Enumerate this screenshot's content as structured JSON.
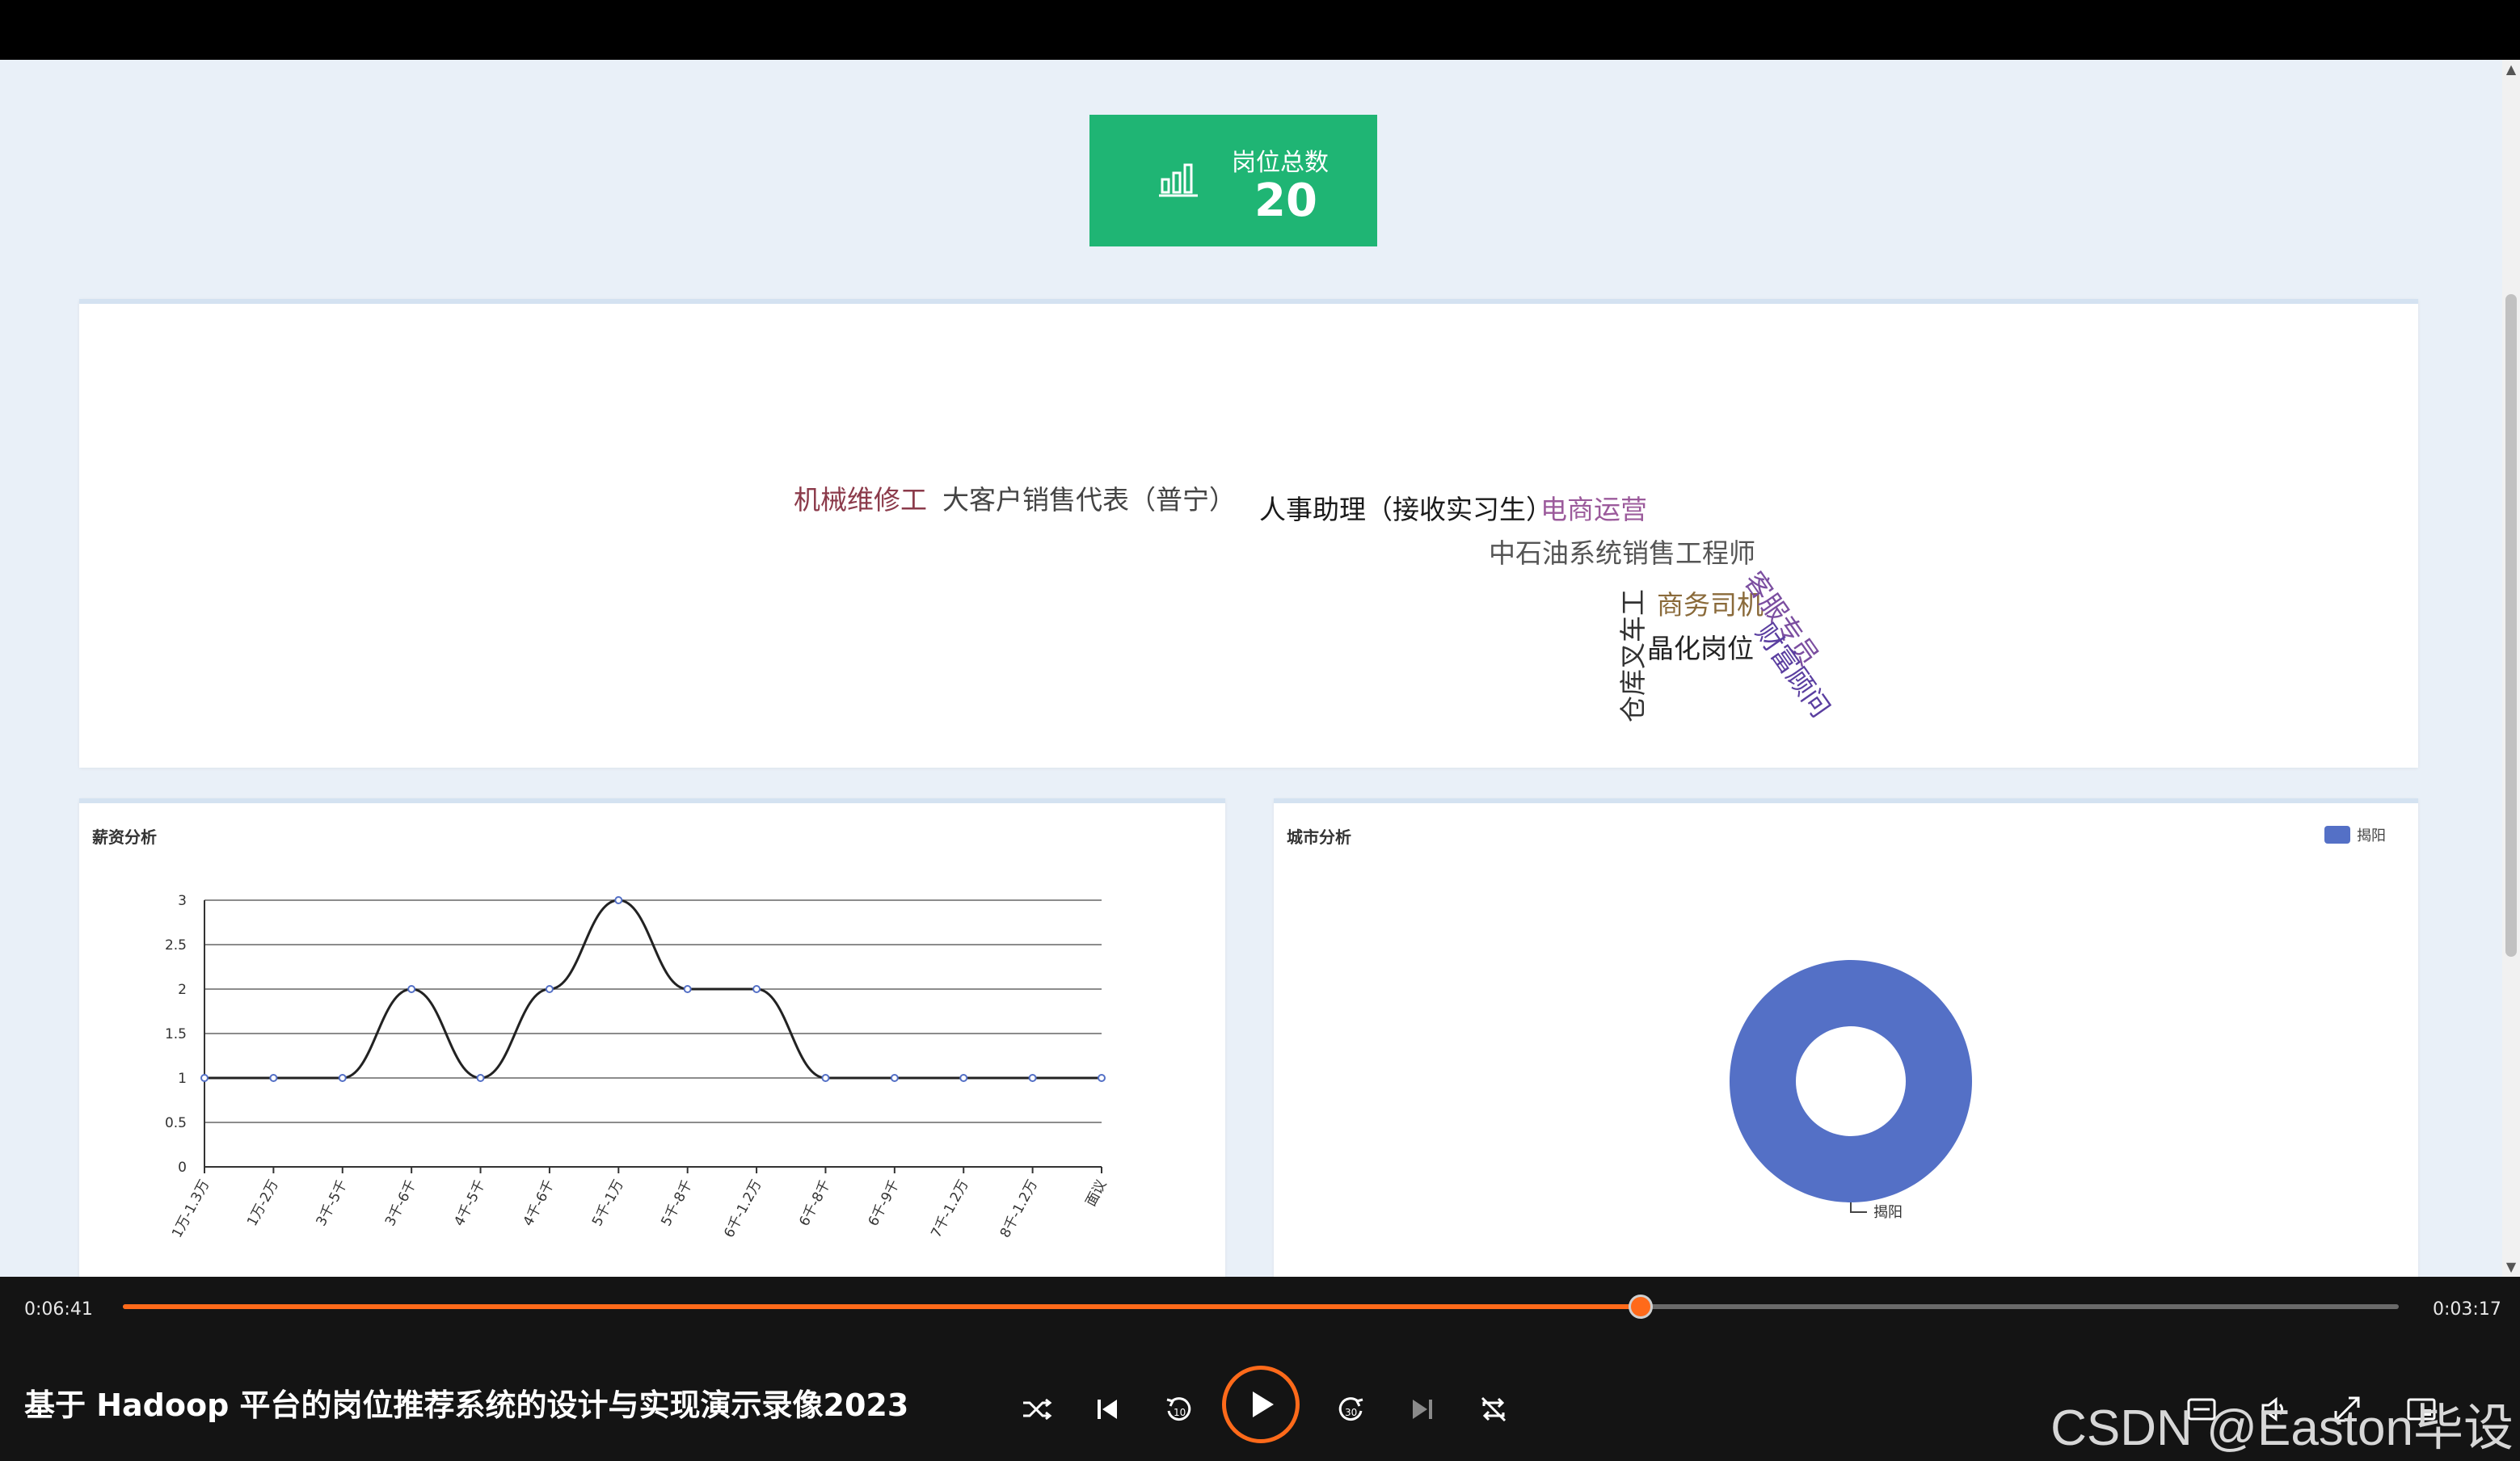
{
  "stat": {
    "label": "岗位总数",
    "value": "20"
  },
  "wordcloud": [
    {
      "text": "机械维修工",
      "color": "#8b3a4a"
    },
    {
      "text": "大客户销售代表（普宁）",
      "color": "#444444"
    },
    {
      "text": "人事助理（接收实习生）",
      "color": "#1a1a1a"
    },
    {
      "text": "电商运营",
      "color": "#9b5a9b"
    },
    {
      "text": "中石油系统销售工程师",
      "color": "#555555"
    },
    {
      "text": "商务司机",
      "color": "#8a6a3a"
    },
    {
      "text": "晶化岗位",
      "color": "#222222"
    },
    {
      "text": "客服专员",
      "color": "#7b4ea0"
    },
    {
      "text": "财富顾问",
      "color": "#5a3ea0"
    },
    {
      "text": "仓库叉车工",
      "color": "#333333"
    }
  ],
  "salary": {
    "title": "薪资分析"
  },
  "city": {
    "title": "城市分析",
    "legend": "揭阳",
    "label": "揭阳"
  },
  "chart_data": [
    {
      "type": "line",
      "title": "薪资分析",
      "categories": [
        "1万-1.3万",
        "1万-2万",
        "3千-5千",
        "3千-6千",
        "4千-5千",
        "4千-6千",
        "5千-1万",
        "5千-8千",
        "6千-1.2万",
        "6千-8千",
        "6千-9千",
        "7千-1.2万",
        "8千-1.2万",
        "面议"
      ],
      "values": [
        1,
        1,
        1,
        2,
        1,
        2,
        3,
        2,
        2,
        1,
        1,
        1,
        1,
        1
      ],
      "ylim": [
        0,
        3
      ],
      "yticks": [
        "0",
        "0.5",
        "1",
        "1.5",
        "2",
        "2.5",
        "3"
      ],
      "smooth": true,
      "grid": true,
      "line_color": "#222222",
      "point_color": "#5470c6"
    },
    {
      "type": "pie",
      "title": "城市分析",
      "donut": true,
      "series": [
        {
          "name": "揭阳",
          "values": [
            20
          ]
        }
      ],
      "categories": [
        "揭阳"
      ],
      "color": "#5470c6",
      "legend": "top-right"
    }
  ],
  "player": {
    "current_time": "0:06:41",
    "remaining_time": "0:03:17",
    "progress": 0.667,
    "title": "基于 Hadoop 平台的岗位推荐系统的设计与实现演示录像2023",
    "accent": "#ff6a1a"
  },
  "watermark": "CSDN @Easton毕设"
}
